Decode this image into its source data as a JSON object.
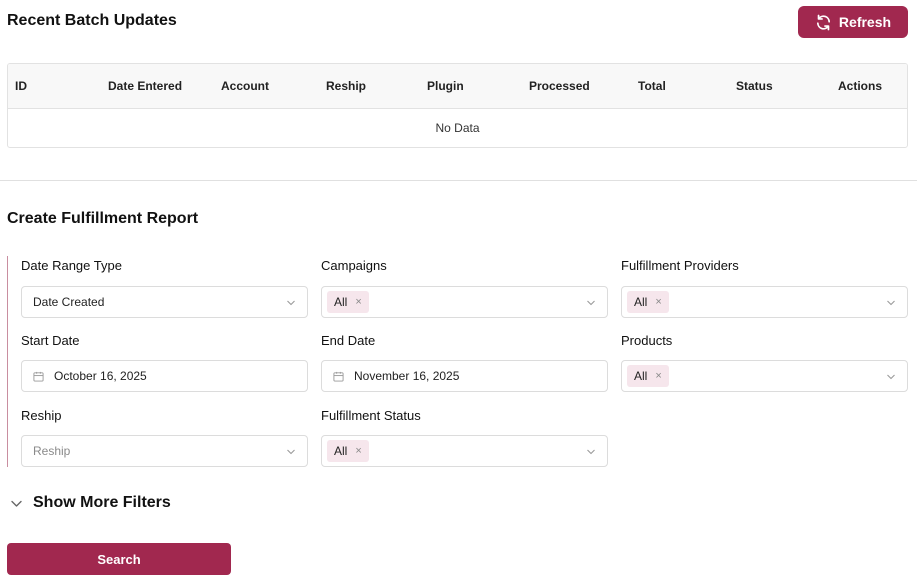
{
  "batch_updates": {
    "title": "Recent Batch Updates",
    "refresh_label": "Refresh",
    "columns": [
      "ID",
      "Date Entered",
      "Account",
      "Reship",
      "Plugin",
      "Processed",
      "Total",
      "Status",
      "Actions"
    ],
    "empty_text": "No Data"
  },
  "report": {
    "title": "Create Fulfillment Report",
    "fields": {
      "date_range_type": {
        "label": "Date Range Type",
        "value": "Date Created"
      },
      "campaigns": {
        "label": "Campaigns",
        "tag": "All"
      },
      "fulfillment_providers": {
        "label": "Fulfillment Providers",
        "tag": "All"
      },
      "start_date": {
        "label": "Start Date",
        "value": "October 16, 2025"
      },
      "end_date": {
        "label": "End Date",
        "value": "November 16, 2025"
      },
      "products": {
        "label": "Products",
        "tag": "All"
      },
      "reship": {
        "label": "Reship",
        "placeholder": "Reship"
      },
      "fulfillment_status": {
        "label": "Fulfillment Status",
        "tag": "All"
      }
    },
    "tag_remove_glyph": "×",
    "more_filters_label": "Show More Filters",
    "search_label": "Search"
  },
  "colors": {
    "accent": "#a1284f",
    "tag_bg": "#f6e6ec",
    "border": "#dcdcdc"
  },
  "icons": {
    "refresh": "refresh-icon",
    "chevron": "chevron-down-icon",
    "calendar": "calendar-icon",
    "remove": "close-icon"
  }
}
